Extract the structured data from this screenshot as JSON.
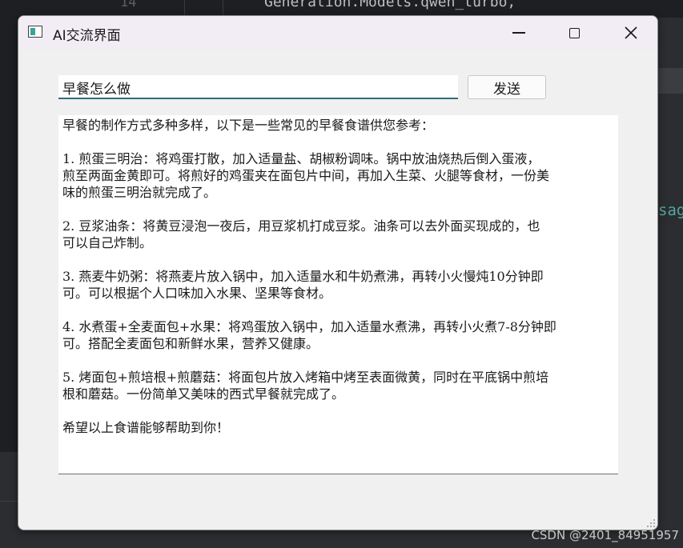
{
  "ide": {
    "line_number": "14",
    "code_line": "Generation.Models.qwen_turbo,",
    "right_fragment": "sag"
  },
  "window": {
    "title": "AI交流界面",
    "icon": "app-window-icon",
    "controls": {
      "minimize_icon": "minimize-icon",
      "maximize_icon": "maximize-icon",
      "close_icon": "close-icon",
      "close_glyph": "✕"
    }
  },
  "query": {
    "value": "早餐怎么做"
  },
  "send_button": {
    "label": "发送"
  },
  "response": {
    "lines": [
      "早餐的制作方式多种多样，以下是一些常见的早餐食谱供您参考：",
      "",
      "1. 煎蛋三明治：将鸡蛋打散，加入适量盐、胡椒粉调味。锅中放油烧热后倒入蛋液，",
      "煎至两面金黄即可。将煎好的鸡蛋夹在面包片中间，再加入生菜、火腿等食材，一份美",
      "味的煎蛋三明治就完成了。",
      "",
      "2. 豆浆油条：将黄豆浸泡一夜后，用豆浆机打成豆浆。油条可以去外面买现成的，也",
      "可以自己炸制。",
      "",
      "3. 燕麦牛奶粥：将燕麦片放入锅中，加入适量水和牛奶煮沸，再转小火慢炖10分钟即",
      "可。可以根据个人口味加入水果、坚果等食材。",
      "",
      "4. 水煮蛋+全麦面包+水果：将鸡蛋放入锅中，加入适量水煮沸，再转小火煮7-8分钟即",
      "可。搭配全麦面包和新鲜水果，营养又健康。",
      "",
      "5. 烤面包+煎培根+煎蘑菇：将面包片放入烤箱中烤至表面微黄，同时在平底锅中煎培",
      "根和蘑菇。一份简单又美味的西式早餐就完成了。",
      "",
      "希望以上食谱能够帮助到你！"
    ]
  },
  "watermark": "CSDN @2401_84951957",
  "colors": {
    "window_bg": "#f0f0f0",
    "titlebar_bg": "#f2ecf4",
    "input_underline": "#2f6f79",
    "icon_accent": "#3aa39c"
  }
}
